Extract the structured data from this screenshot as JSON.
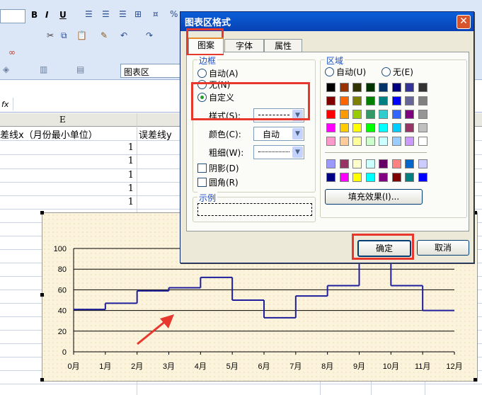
{
  "toolbar": {
    "chart_area_label": "图表区",
    "fx_label": "fx"
  },
  "sheet": {
    "column_header": "E",
    "header_col_e": "差线x（月份最小单位）",
    "header_col_f": "误差线y",
    "values": [
      "1",
      "1",
      "1",
      "1",
      "1"
    ]
  },
  "chart_data": {
    "type": "line",
    "categories": [
      "0月",
      "1月",
      "2月",
      "3月",
      "4月",
      "5月",
      "6月",
      "7月",
      "8月",
      "9月",
      "10月",
      "11月",
      "12月"
    ],
    "yticks": [
      "0",
      "20",
      "40",
      "60",
      "80",
      "100"
    ],
    "ylim": [
      0,
      100
    ],
    "step_series": [
      {
        "x0": 0,
        "x1": 1,
        "y": 41
      },
      {
        "x0": 1,
        "x1": 2,
        "y": 47
      },
      {
        "x0": 2,
        "x1": 3,
        "y": 59
      },
      {
        "x0": 3,
        "x1": 4,
        "y": 62
      },
      {
        "x0": 4,
        "x1": 5,
        "y": 72
      },
      {
        "x0": 5,
        "x1": 6,
        "y": 50
      },
      {
        "x0": 6,
        "x1": 7,
        "y": 33
      },
      {
        "x0": 7,
        "x1": 8,
        "y": 54
      },
      {
        "x0": 8,
        "x1": 9,
        "y": 64
      },
      {
        "x0": 9,
        "x1": 10,
        "y": 100
      },
      {
        "x0": 10,
        "x1": 11,
        "y": 64
      },
      {
        "x0": 11,
        "x1": 12,
        "y": 40
      }
    ],
    "series_color": "#1f1f9c"
  },
  "dialog": {
    "title": "图表区格式",
    "tabs": [
      "图案",
      "字体",
      "属性"
    ],
    "border": {
      "title": "边框",
      "auto": "自动(A)",
      "none": "无(N)",
      "custom": "自定义",
      "style_label": "样式(S):",
      "color_label": "颜色(C):",
      "color_value": "自动",
      "weight_label": "粗细(W):",
      "shadow": "阴影(D)",
      "rounded": "圆角(R)"
    },
    "area": {
      "title": "区域",
      "auto": "自动(U)",
      "none": "无(E)",
      "fill_effects": "填充效果(I)..."
    },
    "sample_title": "示例",
    "ok": "确定",
    "cancel": "取消",
    "palette_main": [
      "#000000",
      "#993300",
      "#333300",
      "#003300",
      "#003366",
      "#000080",
      "#333399",
      "#333333",
      "#800000",
      "#ff6600",
      "#808000",
      "#008000",
      "#008080",
      "#0000ff",
      "#666699",
      "#808080",
      "#ff0000",
      "#ff9900",
      "#99cc00",
      "#339966",
      "#33cccc",
      "#3366ff",
      "#800080",
      "#969696",
      "#ff00ff",
      "#ffcc00",
      "#ffff00",
      "#00ff00",
      "#00ffff",
      "#00ccff",
      "#993366",
      "#c0c0c0",
      "#ff99cc",
      "#ffcc99",
      "#ffff99",
      "#ccffcc",
      "#ccffff",
      "#99ccff",
      "#cc99ff",
      "#ffffff"
    ],
    "palette_extra": [
      "#9999ff",
      "#993366",
      "#ffffcc",
      "#ccffff",
      "#660066",
      "#ff8080",
      "#0066cc",
      "#ccccff",
      "#000080",
      "#ff00ff",
      "#ffff00",
      "#00ffff",
      "#800080",
      "#800000",
      "#008080",
      "#0000ff"
    ]
  }
}
